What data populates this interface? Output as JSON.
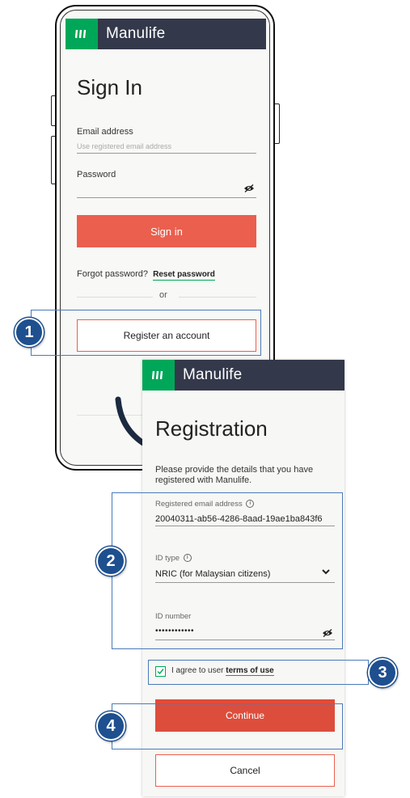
{
  "signin": {
    "brand": "Manulife",
    "title": "Sign In",
    "email_label": "Email address",
    "email_placeholder": "Use registered email address",
    "password_label": "Password",
    "signin_button": "Sign in",
    "forgot_text": "Forgot password?",
    "reset_link": "Reset password",
    "or_text": "or",
    "register_button": "Register an account"
  },
  "registration": {
    "brand": "Manulife",
    "title": "Registration",
    "description": "Please provide the details that you have registered with Manulife.",
    "email_label": "Registered email address",
    "email_value": "20040311-ab56-4286-8aad-19ae1ba843f6",
    "id_type_label": "ID type",
    "id_type_value": "NRIC (for Malaysian citizens)",
    "id_number_label": "ID number",
    "id_number_value": "••••••••••••",
    "agree_text": "I agree to user",
    "terms_link": "terms of use",
    "agree_checked": true,
    "continue_button": "Continue",
    "cancel_button": "Cancel"
  },
  "annotations": {
    "step1": "1",
    "step2": "2",
    "step3": "3",
    "step4": "4"
  },
  "colors": {
    "brand_green": "#00a758",
    "brand_navy": "#34384b",
    "button_coral": "#ea5f4e",
    "annotation_blue": "#1e4f8f"
  }
}
